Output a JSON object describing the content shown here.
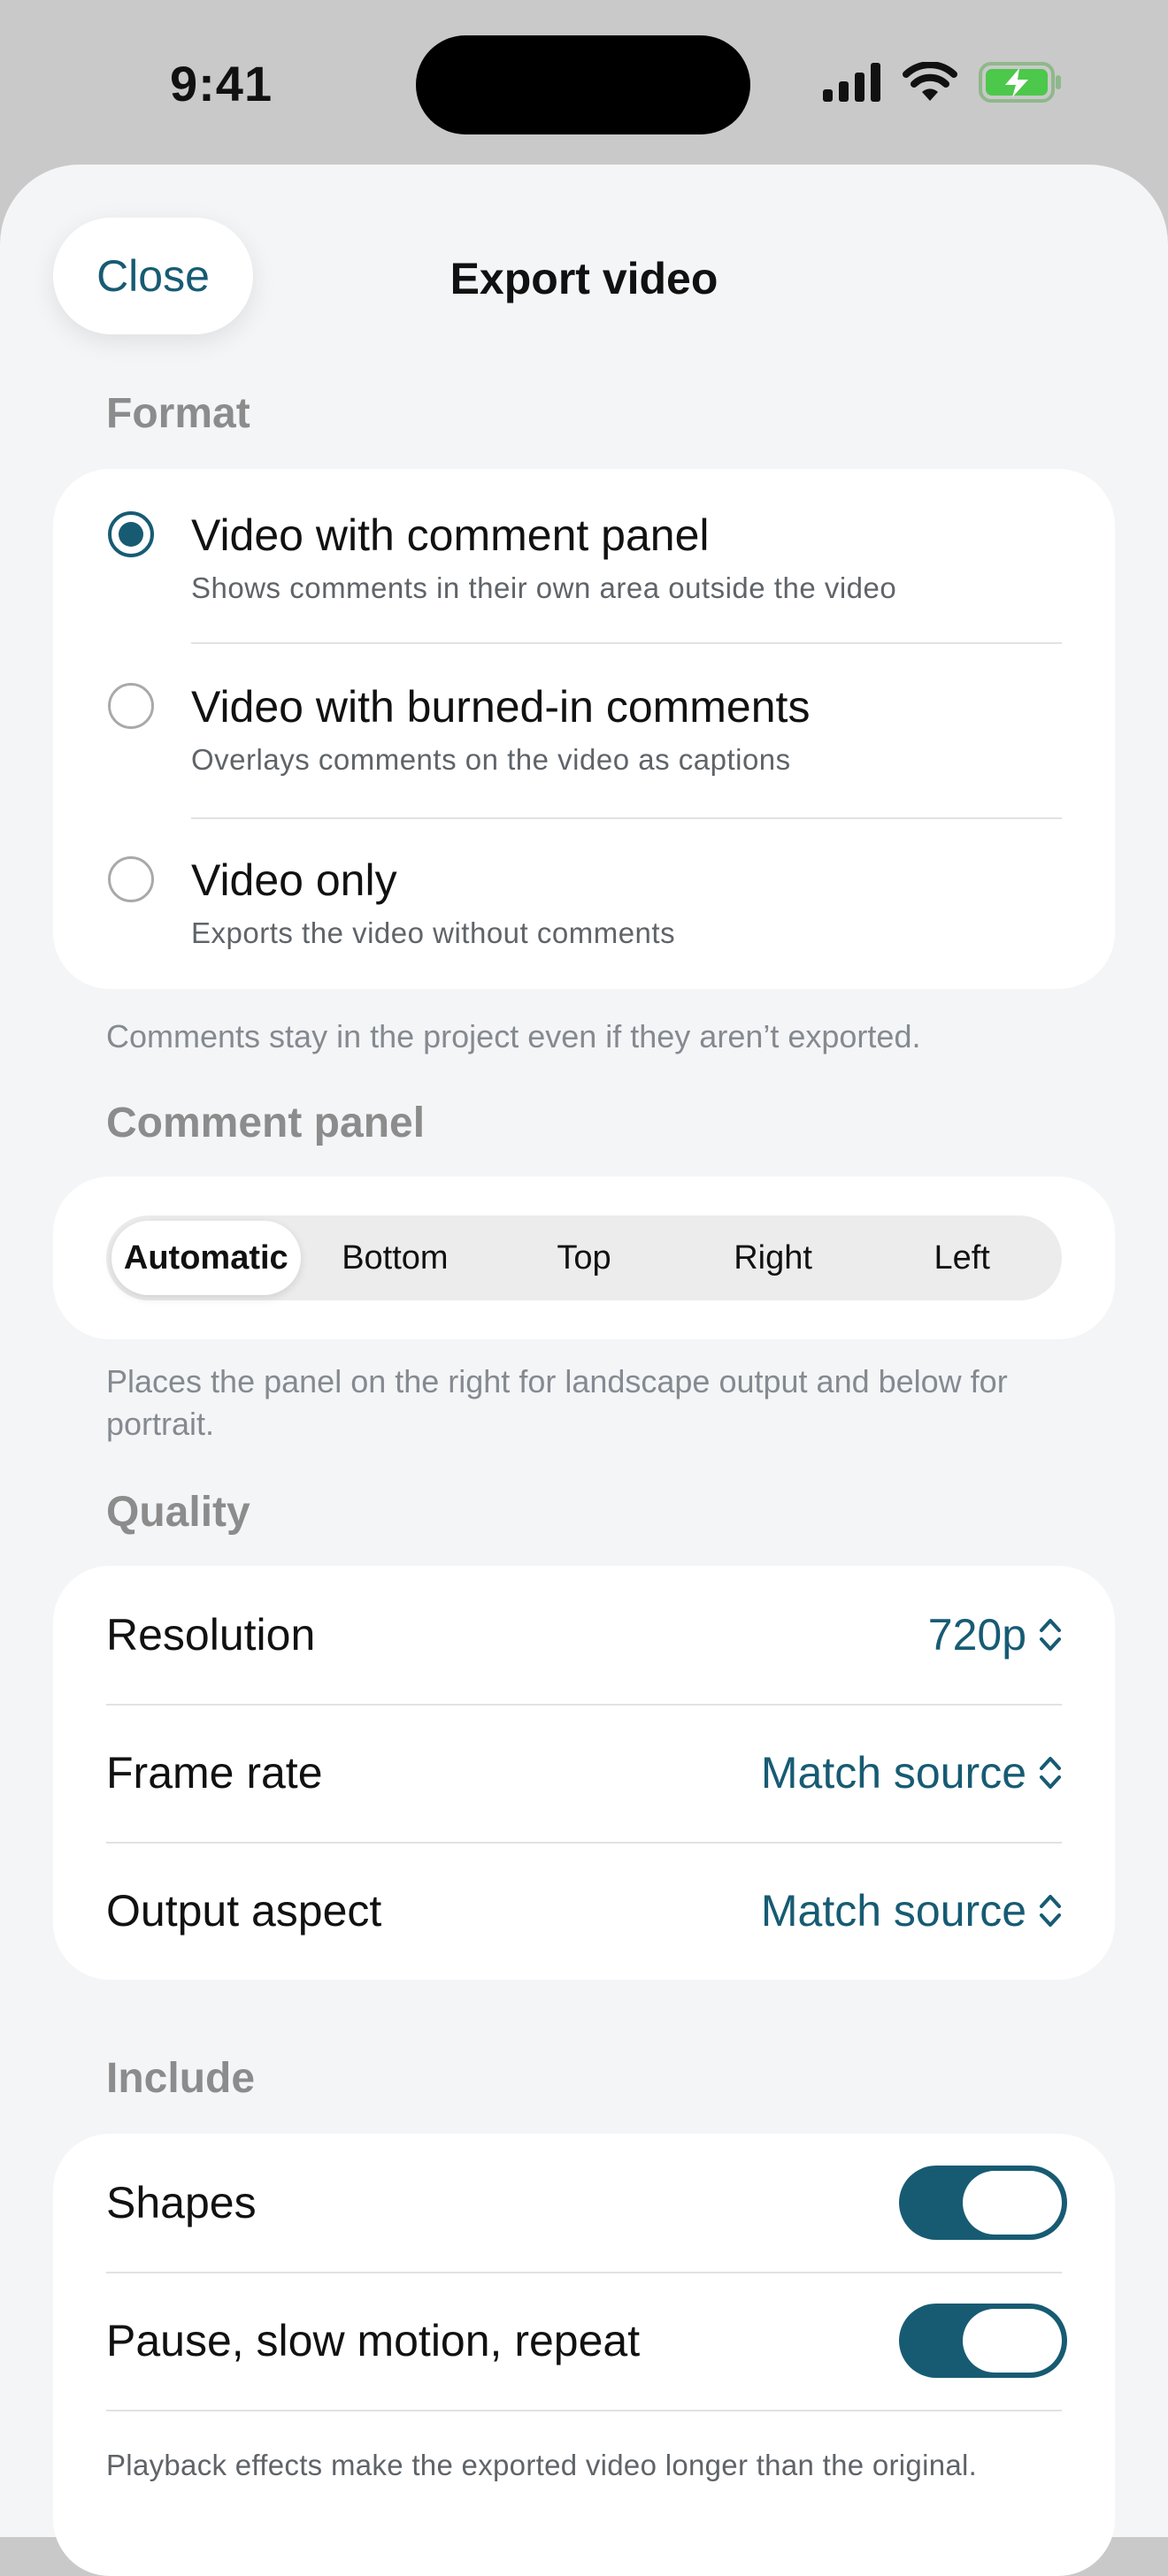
{
  "status": {
    "time": "9:41"
  },
  "header": {
    "title": "Export video",
    "close_label": "Close"
  },
  "format": {
    "label": "Format",
    "options": [
      {
        "title": "Video with comment panel",
        "subtitle": "Shows comments in their own area outside the video",
        "selected": true
      },
      {
        "title": "Video with burned-in comments",
        "subtitle": "Overlays comments on the video as captions",
        "selected": false
      },
      {
        "title": "Video only",
        "subtitle": "Exports the video without comments",
        "selected": false
      }
    ],
    "footnote": "Comments stay in the project even if they aren’t exported."
  },
  "comment_panel": {
    "label": "Comment panel",
    "segments": [
      "Automatic",
      "Bottom",
      "Top",
      "Right",
      "Left"
    ],
    "selected": "Automatic",
    "footnote": "Places the panel on the right for landscape output and below for portrait."
  },
  "quality": {
    "label": "Quality",
    "rows": [
      {
        "label": "Resolution",
        "value": "720p"
      },
      {
        "label": "Frame rate",
        "value": "Match source"
      },
      {
        "label": "Output aspect",
        "value": "Match source"
      }
    ]
  },
  "include": {
    "label": "Include",
    "rows": [
      {
        "label": "Shapes",
        "on": true
      },
      {
        "label": "Pause, slow motion, repeat",
        "on": true
      }
    ],
    "note": "Playback effects make the exported video longer than the original."
  },
  "colors": {
    "accent": "#175b73",
    "background": "#f4f5f7",
    "toggle_on": "#175b73"
  },
  "icons": [
    "cellular-signal-icon",
    "wifi-icon",
    "battery-charging-icon",
    "chevron-up-down-icon"
  ]
}
